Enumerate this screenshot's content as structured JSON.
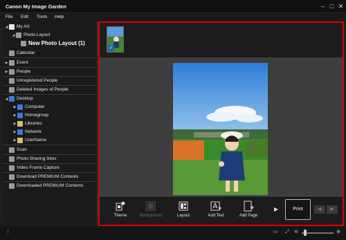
{
  "window": {
    "title": "Canon My Image Garden"
  },
  "menu": {
    "file": "File",
    "edit": "Edit",
    "tools": "Tools",
    "help": "Help"
  },
  "sidebar": {
    "my_art": "My Art",
    "photo_layout": "Photo Layout",
    "new_photo_layout": "New Photo Layout (1)",
    "calendar": "Calendar",
    "event": "Event",
    "people": "People",
    "unregistered_people": "Unregistered People",
    "deleted_images_of_people": "Deleted Images of People",
    "desktop": "Desktop",
    "computer": "Computer",
    "homegroup": "Homegroup",
    "libraries": "Libraries",
    "network": "Network",
    "username": "UserName",
    "scan": "Scan",
    "photo_sharing_sites": "Photo Sharing Sites",
    "video_frame_capture": "Video Frame Capture",
    "download_premium": "Download PREMIUM Contents",
    "downloaded_premium": "Downloaded PREMIUM Contents"
  },
  "toolbar": {
    "theme": "Theme",
    "background": "Background",
    "layout": "Layout",
    "add_text": "Add Text",
    "add_page": "Add Page",
    "print": "Print"
  },
  "colors": {
    "highlight_border": "#e00000",
    "accent_blue": "#3d78d6"
  }
}
